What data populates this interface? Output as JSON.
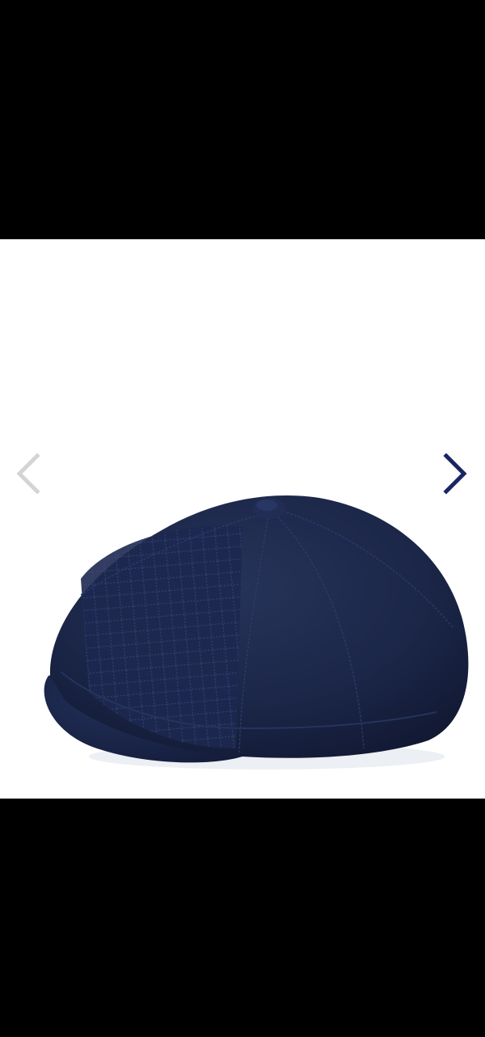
{
  "colors": {
    "background": "#000000",
    "gallery_background": "#ffffff",
    "arrow_prev": "#d4d4d6",
    "arrow_next": "#1c2563",
    "cap_main": "#1b2648",
    "cap_shadow": "#121a34"
  },
  "gallery": {
    "prev_icon": "chevron-left-icon",
    "next_icon": "chevron-right-icon",
    "image_subject": "navy flat cap"
  }
}
